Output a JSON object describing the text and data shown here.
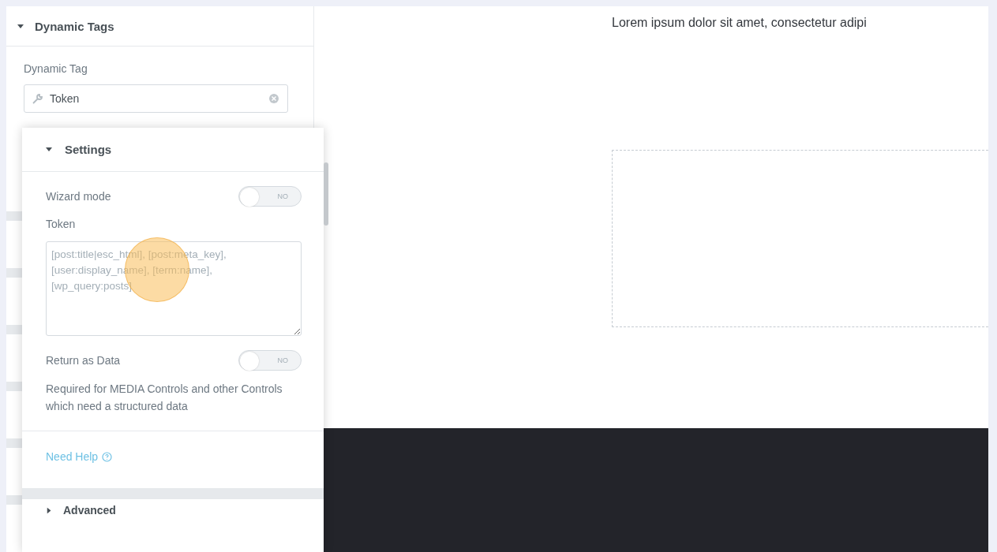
{
  "panel": {
    "section_title": "Dynamic Tags",
    "expanded": true,
    "field_label": "Dynamic Tag",
    "field_value": "Token"
  },
  "popup": {
    "section_title": "Settings",
    "expanded": true,
    "controls": [
      {
        "kind": "switch",
        "label": "Wizard mode",
        "on": false,
        "state_text": "NO"
      },
      {
        "kind": "textarea",
        "label": "Token",
        "placeholder": "[post:title|esc_html], [post:meta_key], [user:display_name], [term:name], [wp_query:posts]"
      },
      {
        "kind": "switch",
        "label": "Return as Data",
        "on": false,
        "state_text": "NO"
      },
      {
        "kind": "note",
        "text": "Required for MEDIA Controls and other Controls which need a structured data"
      }
    ],
    "help_link": "Need Help",
    "next_section_title": "Advanced",
    "next_section_expanded": false
  },
  "canvas": {
    "heading": "Lorem ipsum dolor sit amet, consectetur adipi"
  }
}
